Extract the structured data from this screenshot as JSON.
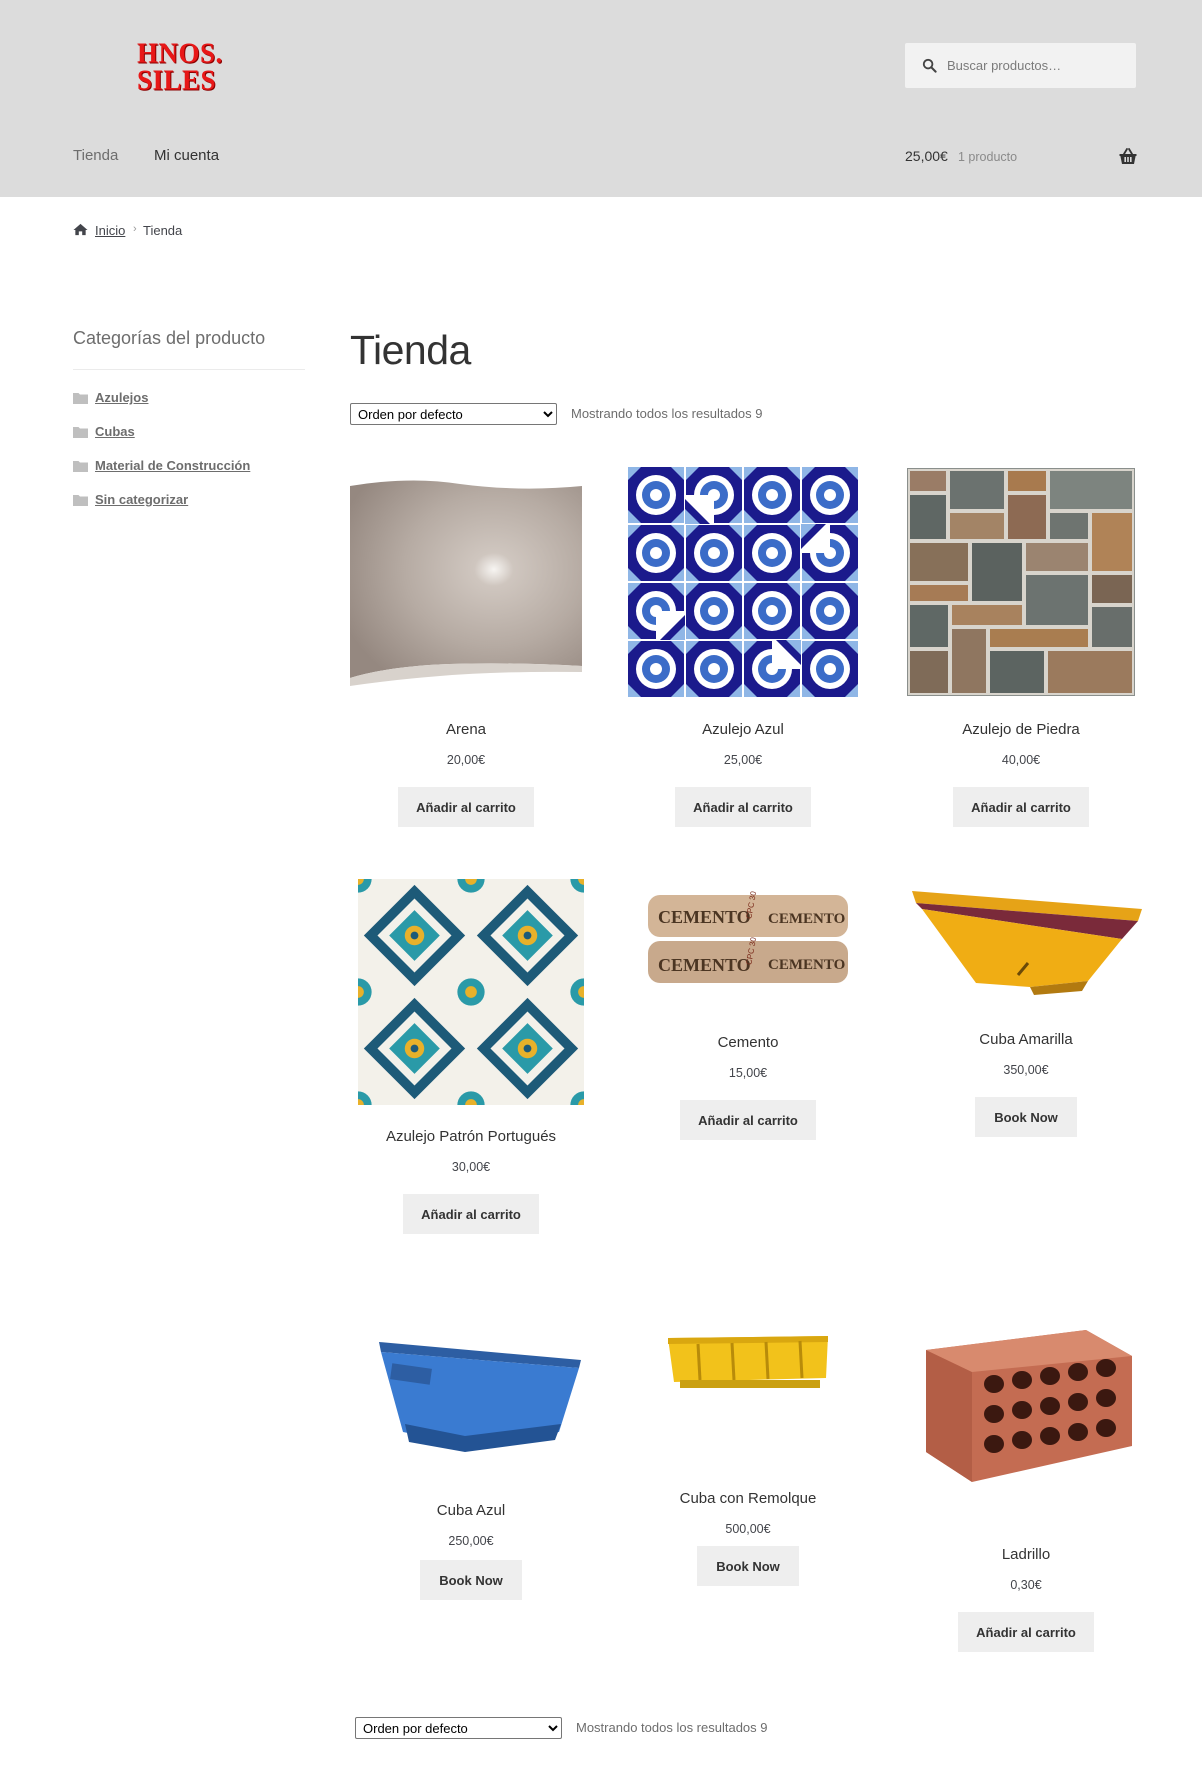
{
  "header": {
    "logo_line1": "HNOS.",
    "logo_line2": "SILES",
    "search_placeholder": "Buscar productos…",
    "nav": [
      "Tienda",
      "Mi cuenta"
    ],
    "cart_amount": "25,00€",
    "cart_count": "1 producto",
    "brand_color": "#e81818",
    "header_bg": "#dcdcdc"
  },
  "breadcrumb": {
    "home": "Inicio",
    "separator": "›",
    "current": "Tienda"
  },
  "sidebar": {
    "title": "Categorías del producto",
    "categories": [
      "Azulejos",
      "Cubas",
      "Material de Construcción",
      "Sin categorizar"
    ]
  },
  "main": {
    "title": "Tienda",
    "ordering": {
      "selected": "Orden por defecto",
      "result_count": "Mostrando todos los resultados 9"
    },
    "products": [
      {
        "name": "Arena",
        "price": "20,00€",
        "button": "Añadir al carrito",
        "icon": "sand-bag-image"
      },
      {
        "name": "Azulejo Azul",
        "price": "25,00€",
        "button": "Añadir al carrito",
        "icon": "blue-tile-image"
      },
      {
        "name": "Azulejo de Piedra",
        "price": "40,00€",
        "button": "Añadir al carrito",
        "icon": "stone-tile-image"
      },
      {
        "name": "Azulejo Patrón Portugués",
        "price": "30,00€",
        "button": "Añadir al carrito",
        "icon": "portuguese-tile-image"
      },
      {
        "name": "Cemento",
        "price": "15,00€",
        "button": "Añadir al carrito",
        "icon": "cement-bags-image",
        "bag_label": "CEMENTO",
        "bag_code": "CPC 30"
      },
      {
        "name": "Cuba Amarilla",
        "price": "350,00€",
        "button": "Book Now",
        "icon": "yellow-skip-image"
      },
      {
        "name": "Cuba Azul",
        "price": "250,00€",
        "button": "Book Now",
        "icon": "blue-skip-image"
      },
      {
        "name": "Cuba con Remolque",
        "price": "500,00€",
        "button": "Book Now",
        "icon": "yellow-trailer-skip-image"
      },
      {
        "name": "Ladrillo",
        "price": "0,30€",
        "button": "Añadir al carrito",
        "icon": "brick-image"
      }
    ]
  }
}
